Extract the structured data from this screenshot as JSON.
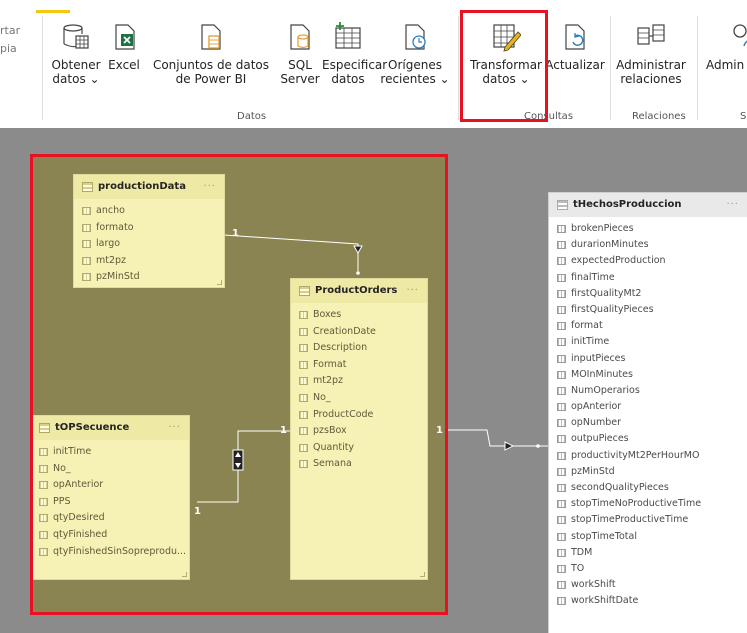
{
  "ribbon": {
    "top_strip": [
      "ortar",
      "pia"
    ],
    "left_partial": [
      "rtar",
      "pia"
    ],
    "buttons": {
      "get_data": "Obtener datos ⌄",
      "excel": "Excel",
      "pbi_datasets": "Conjuntos de datos de Power BI",
      "sql": "SQL Server",
      "enter_data": "Especificar datos",
      "recent": "Orígenes recientes ⌄",
      "transform": "Transformar datos ⌄",
      "refresh": "Actualizar",
      "manage_rel": "Administrar relaciones",
      "manage_roles": "Admin rol"
    },
    "groups": {
      "data": "Datos",
      "queries": "Consultas",
      "relations": "Relaciones",
      "security": "S"
    }
  },
  "tables": {
    "productionData": {
      "name": "productionData",
      "fields": [
        "ancho",
        "formato",
        "largo",
        "mt2pz",
        "pzMinStd"
      ]
    },
    "productOrders": {
      "name": "ProductOrders",
      "fields": [
        "Boxes",
        "CreationDate",
        "Description",
        "Format",
        "mt2pz",
        "No_",
        "ProductCode",
        "pzsBox",
        "Quantity",
        "Semana"
      ]
    },
    "tOPSecuence": {
      "name": "tOPSecuence",
      "fields": [
        "initTime",
        "No_",
        "opAnterior",
        "PPS",
        "qtyDesired",
        "qtyFinished",
        "qtyFinishedSinSopreprodu..."
      ]
    },
    "tHechosProduccion": {
      "name": "tHechosProduccion",
      "fields": [
        "brokenPieces",
        "durarionMinutes",
        "expectedProduction",
        "finalTime",
        "firstQualityMt2",
        "firstQualityPieces",
        "format",
        "initTime",
        "inputPieces",
        "MOInMinutes",
        "NumOperarios",
        "opAnterior",
        "opNumber",
        "outpuPieces",
        "productivityMt2PerHourMO",
        "pzMinStd",
        "secondQualityPieces",
        "stopTimeNoProductiveTime",
        "stopTimeProductiveTime",
        "stopTimeTotal",
        "TDM",
        "TO",
        "workShift",
        "workShiftDate"
      ]
    }
  },
  "relationships": {
    "prod_to_orders": "1",
    "seq_to_orders_left": "1",
    "seq_to_orders_right": "1",
    "orders_to_hechos": "1"
  },
  "dots": "···"
}
